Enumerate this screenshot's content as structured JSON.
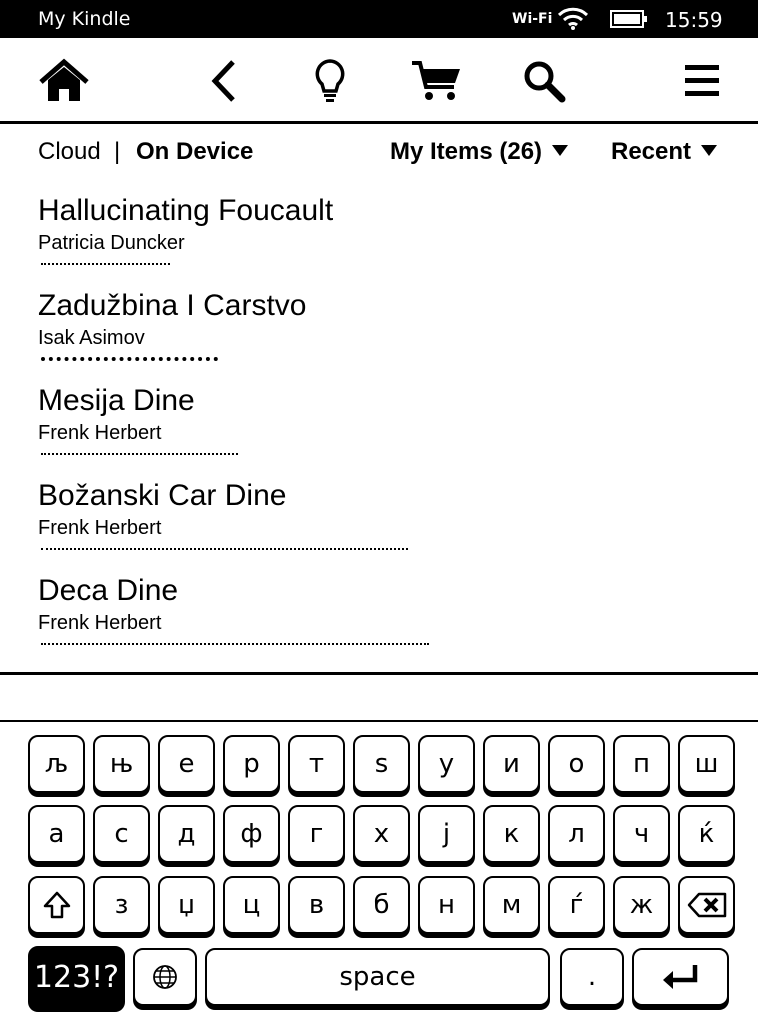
{
  "status_bar": {
    "app_title": "My Kindle",
    "wifi_label": "Wi-Fi",
    "time": "15:59",
    "icons": [
      "wifi-icon",
      "battery-icon"
    ]
  },
  "toolbar": {
    "icons": [
      "home-icon",
      "back-icon",
      "lightbulb-icon",
      "cart-icon",
      "search-icon",
      "menu-icon"
    ]
  },
  "filter_bar": {
    "cloud": "Cloud",
    "separator": "|",
    "on_device": "On Device",
    "my_items": "My Items (26)",
    "sort": "Recent"
  },
  "books": [
    {
      "title": "Hallucinating Foucault",
      "author": "Patricia Duncker",
      "progress": 0.19
    },
    {
      "title": "Zadužbina I Carstvo",
      "author": "Isak Asimov",
      "progress": 0.26
    },
    {
      "title": "Mesija Dine",
      "author": "Frenk Herbert",
      "progress": 0.29
    },
    {
      "title": "Božanski Car Dine",
      "author": "Frenk Herbert",
      "progress": 0.54
    },
    {
      "title": "Deca Dine",
      "author": "Frenk Herbert",
      "progress": 0.57
    }
  ],
  "keyboard": {
    "row1": [
      "љ",
      "њ",
      "е",
      "р",
      "т",
      "ѕ",
      "у",
      "и",
      "о",
      "п",
      "ш"
    ],
    "row2": [
      "а",
      "с",
      "д",
      "ф",
      "г",
      "х",
      "ј",
      "к",
      "л",
      "ч",
      "ќ"
    ],
    "row3": [
      "з",
      "џ",
      "ц",
      "в",
      "б",
      "н",
      "м",
      "ѓ",
      "ж"
    ],
    "symbols_key": "123!?",
    "space_key": "space",
    "period_key": ".",
    "special_icons": [
      "shift-icon",
      "backspace-icon",
      "globe-icon",
      "enter-icon"
    ]
  }
}
